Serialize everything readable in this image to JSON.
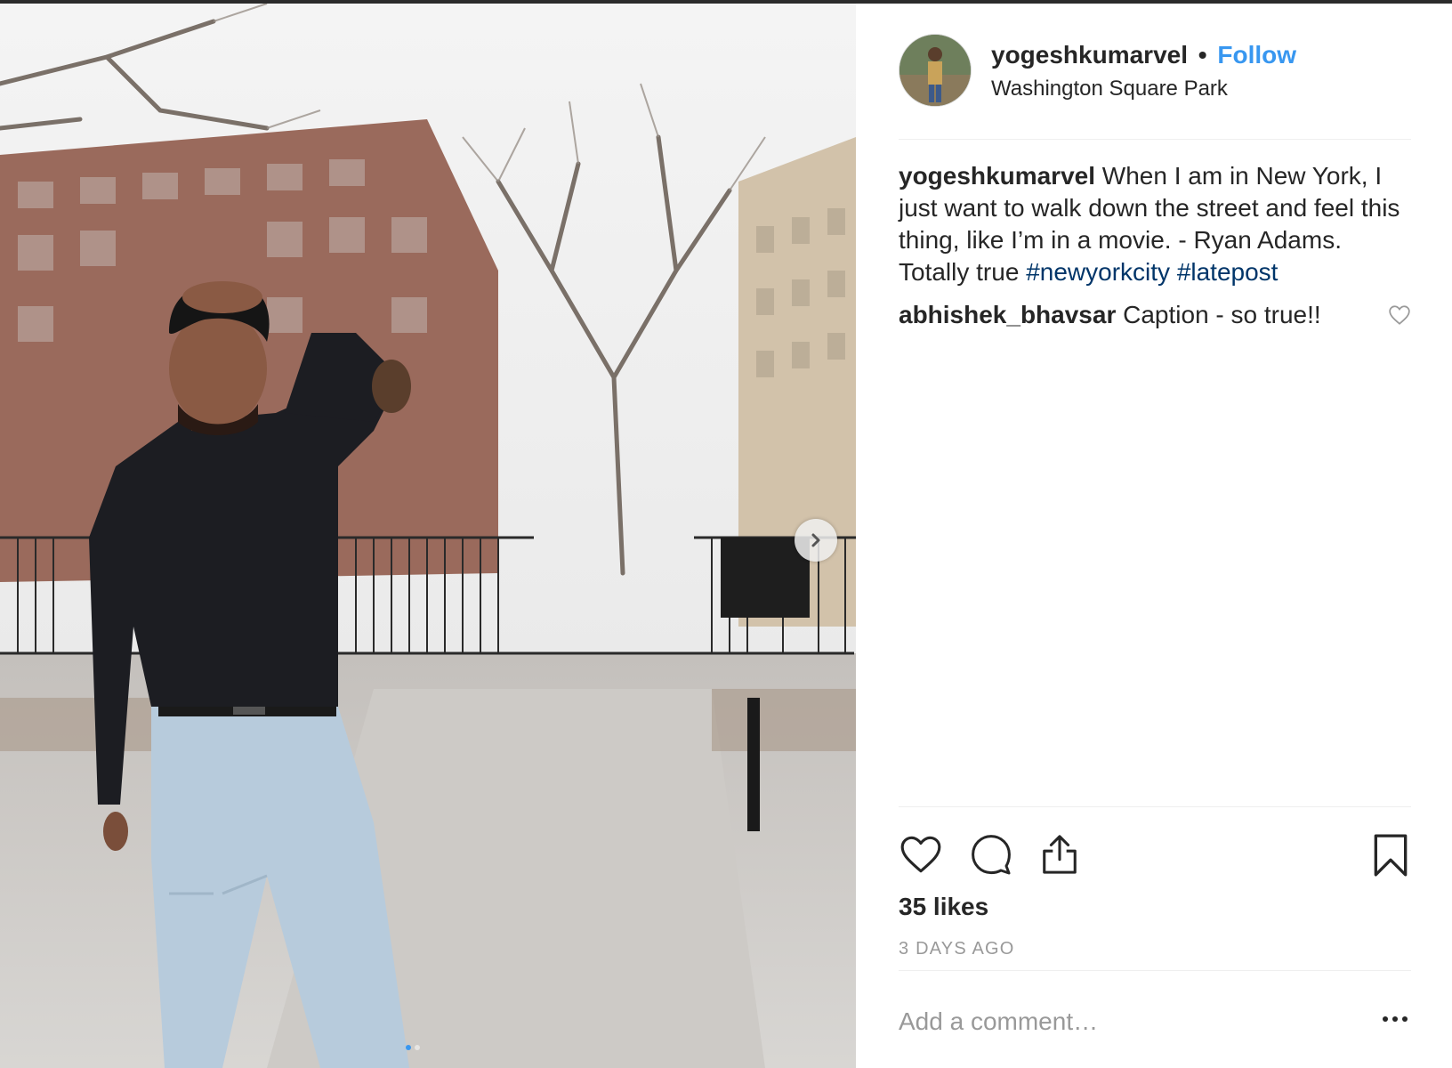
{
  "post": {
    "username": "yogeshkumarvel",
    "separator": "•",
    "follow_label": "Follow",
    "location": "Washington Square Park"
  },
  "caption": {
    "username": "yogeshkumarvel",
    "text": "When I am in New York, I just want to walk down the street and feel this thing, like I’m in a movie. - Ryan Adams. Totally true",
    "hashtags": [
      "#newyorkcity",
      "#latepost"
    ]
  },
  "comments": [
    {
      "username": "abhishek_bhavsar",
      "text": "Caption - so true!!"
    }
  ],
  "actions": {
    "like_icon": "heart-icon",
    "comment_icon": "comment-bubble-icon",
    "share_icon": "share-icon",
    "save_icon": "bookmark-icon"
  },
  "stats": {
    "likes": "35 likes",
    "time_ago": "3 DAYS AGO"
  },
  "comment_box": {
    "placeholder": "Add a comment…",
    "value": ""
  },
  "carousel": {
    "current_slide": 1,
    "slide_count": 2
  },
  "colors": {
    "link_blue": "#3897f0",
    "hashtag": "#003569",
    "text": "#262626",
    "muted": "#999999"
  }
}
